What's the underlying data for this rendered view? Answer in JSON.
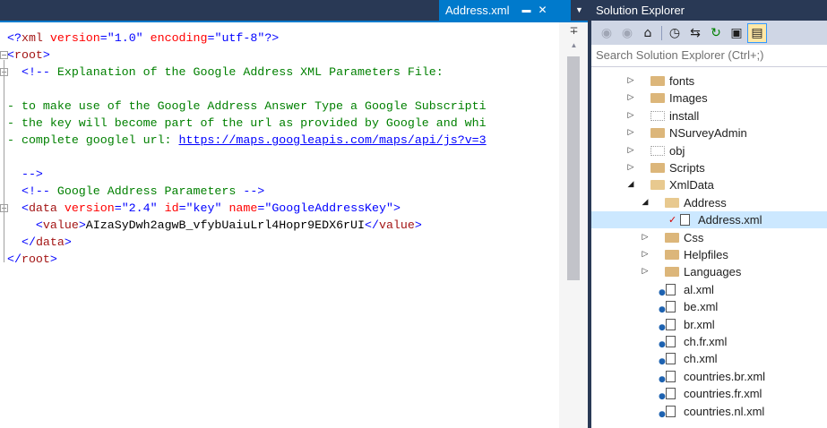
{
  "editor": {
    "tab": {
      "title": "Address.xml",
      "pin_icon": "pin-icon",
      "close_icon": "close-icon"
    },
    "code_lines": [
      {
        "parts": [
          [
            "k",
            "<?"
          ],
          [
            "t",
            "xml"
          ],
          [
            "p",
            " "
          ],
          [
            "a",
            "version"
          ],
          [
            "k",
            "="
          ],
          [
            "v",
            "\"1.0\""
          ],
          [
            "p",
            " "
          ],
          [
            "a",
            "encoding"
          ],
          [
            "k",
            "="
          ],
          [
            "v",
            "\"utf-8\""
          ],
          [
            "k",
            "?>"
          ]
        ]
      },
      {
        "parts": [
          [
            "k",
            "<"
          ],
          [
            "t",
            "root"
          ],
          [
            "k",
            ">"
          ]
        ]
      },
      {
        "parts": [
          [
            "p",
            "  "
          ],
          [
            "k",
            "<!--"
          ],
          [
            "c",
            " Explanation of the Google Address XML Parameters File:"
          ]
        ]
      },
      {
        "parts": [
          [
            "p",
            ""
          ]
        ]
      },
      {
        "parts": [
          [
            "c",
            "- to make use of the Google Address Answer Type a Google Subscripti"
          ]
        ]
      },
      {
        "parts": [
          [
            "c",
            "- the key will become part of the url as provided by Google and whi"
          ]
        ]
      },
      {
        "parts": [
          [
            "c",
            "- complete googlel url: "
          ],
          [
            "lnk",
            "https://maps.googleapis.com/maps/api/js?v=3"
          ]
        ]
      },
      {
        "parts": [
          [
            "p",
            ""
          ]
        ]
      },
      {
        "parts": [
          [
            "c",
            "  "
          ],
          [
            "k",
            "-->"
          ]
        ]
      },
      {
        "parts": [
          [
            "p",
            "  "
          ],
          [
            "k",
            "<!--"
          ],
          [
            "c",
            " Google Address Parameters "
          ],
          [
            "k",
            "-->"
          ]
        ]
      },
      {
        "parts": [
          [
            "p",
            "  "
          ],
          [
            "k",
            "<"
          ],
          [
            "t",
            "data"
          ],
          [
            "p",
            " "
          ],
          [
            "a",
            "version"
          ],
          [
            "k",
            "="
          ],
          [
            "v",
            "\"2.4\""
          ],
          [
            "p",
            " "
          ],
          [
            "a",
            "id"
          ],
          [
            "k",
            "="
          ],
          [
            "v",
            "\"key\""
          ],
          [
            "p",
            " "
          ],
          [
            "a",
            "name"
          ],
          [
            "k",
            "="
          ],
          [
            "v",
            "\"GoogleAddressKey\""
          ],
          [
            "k",
            ">"
          ]
        ]
      },
      {
        "parts": [
          [
            "p",
            "    "
          ],
          [
            "k",
            "<"
          ],
          [
            "t",
            "value"
          ],
          [
            "k",
            ">"
          ],
          [
            "p",
            "AIzaSyDwh2agwB_vfybUaiuLrl4Hopr9EDX6rUI"
          ],
          [
            "k",
            "</"
          ],
          [
            "t",
            "value"
          ],
          [
            "k",
            ">"
          ]
        ]
      },
      {
        "parts": [
          [
            "p",
            "  "
          ],
          [
            "k",
            "</"
          ],
          [
            "t",
            "data"
          ],
          [
            "k",
            ">"
          ]
        ]
      },
      {
        "parts": [
          [
            "k",
            "</"
          ],
          [
            "t",
            "root"
          ],
          [
            "k",
            ">"
          ]
        ]
      }
    ]
  },
  "solution_explorer": {
    "title": "Solution Explorer",
    "search_placeholder": "Search Solution Explorer (Ctrl+;)",
    "toolbar": [
      "back-icon",
      "forward-icon",
      "home-icon",
      "history-icon",
      "sync-icon",
      "refresh-icon",
      "collapse-all-icon",
      "show-all-files-icon"
    ],
    "tree": [
      {
        "label": "fonts",
        "depth": 0,
        "type": "folder",
        "expanded": false
      },
      {
        "label": "Images",
        "depth": 0,
        "type": "folder",
        "expanded": false
      },
      {
        "label": "install",
        "depth": 0,
        "type": "folder-excluded",
        "expanded": false
      },
      {
        "label": "NSurveyAdmin",
        "depth": 0,
        "type": "folder",
        "expanded": false
      },
      {
        "label": "obj",
        "depth": 0,
        "type": "folder-excluded",
        "expanded": false
      },
      {
        "label": "Scripts",
        "depth": 0,
        "type": "folder",
        "expanded": false
      },
      {
        "label": "XmlData",
        "depth": 0,
        "type": "folder-open",
        "expanded": true
      },
      {
        "label": "Address",
        "depth": 1,
        "type": "folder-open",
        "expanded": true
      },
      {
        "label": "Address.xml",
        "depth": 2,
        "type": "file-checked",
        "selected": true
      },
      {
        "label": "Css",
        "depth": 1,
        "type": "folder",
        "expanded": false
      },
      {
        "label": "Helpfiles",
        "depth": 1,
        "type": "folder",
        "expanded": false
      },
      {
        "label": "Languages",
        "depth": 1,
        "type": "folder",
        "expanded": false
      },
      {
        "label": "al.xml",
        "depth": 1,
        "type": "file-locked"
      },
      {
        "label": "be.xml",
        "depth": 1,
        "type": "file-locked"
      },
      {
        "label": "br.xml",
        "depth": 1,
        "type": "file-locked"
      },
      {
        "label": "ch.fr.xml",
        "depth": 1,
        "type": "file-locked"
      },
      {
        "label": "ch.xml",
        "depth": 1,
        "type": "file-locked"
      },
      {
        "label": "countries.br.xml",
        "depth": 1,
        "type": "file-locked"
      },
      {
        "label": "countries.fr.xml",
        "depth": 1,
        "type": "file-locked"
      },
      {
        "label": "countries.nl.xml",
        "depth": 1,
        "type": "file-locked"
      }
    ]
  }
}
